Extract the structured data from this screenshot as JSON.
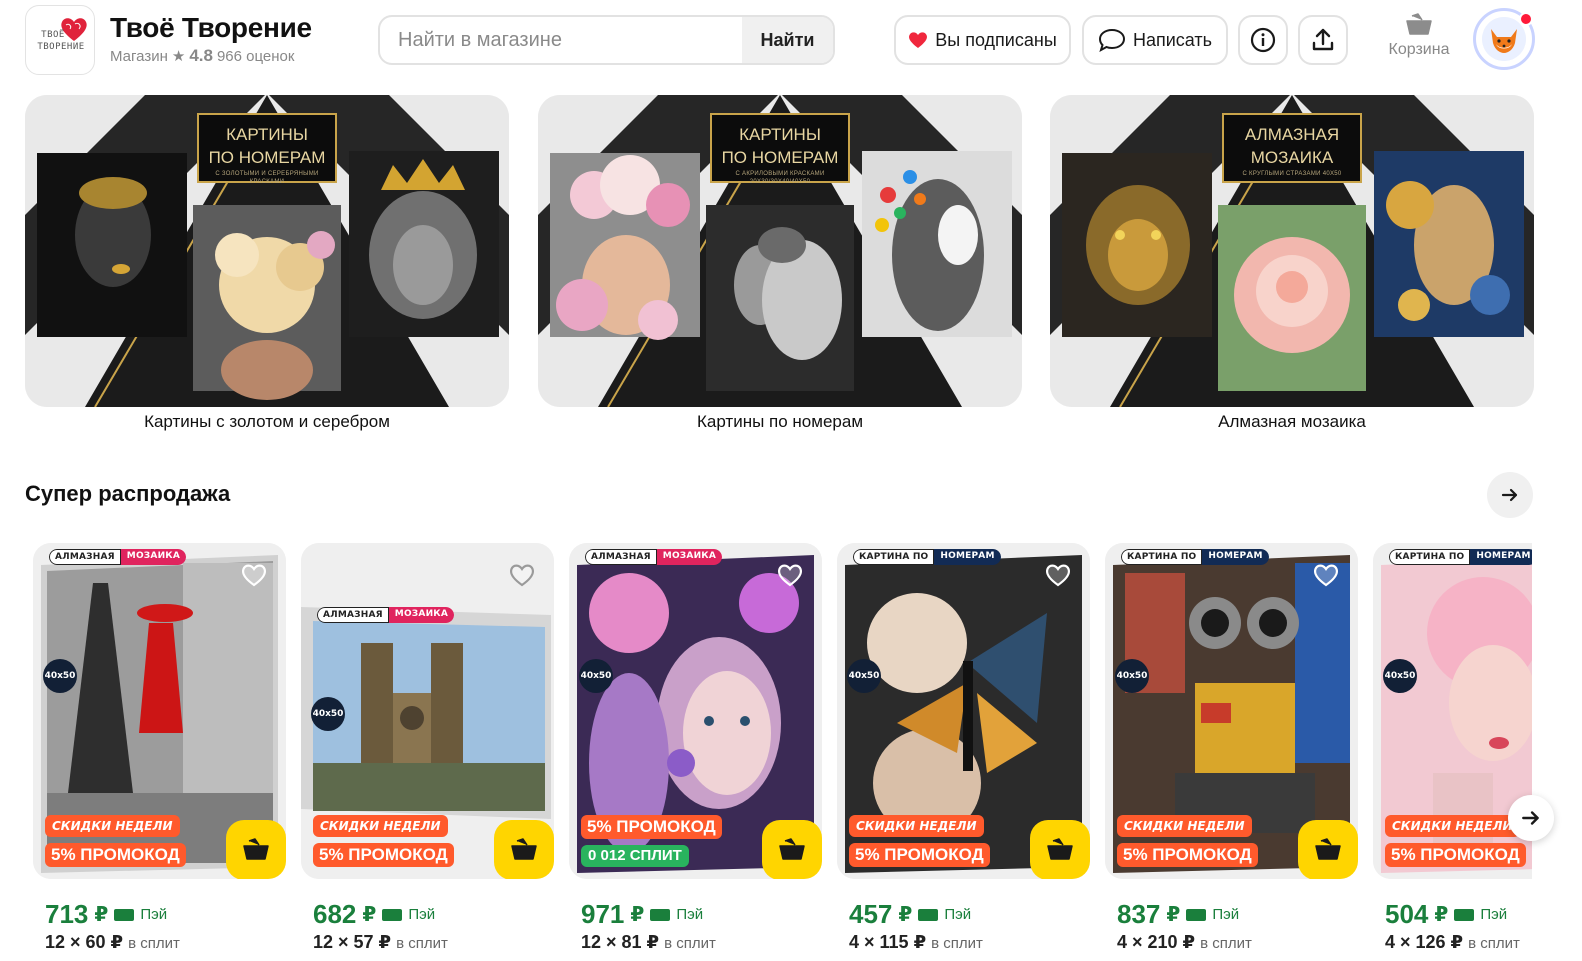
{
  "shop": {
    "logo_line1": "ТВОЁ",
    "logo_line2": "ТВОРЕНИЕ",
    "name": "Твоё Творение",
    "type_label": "Магазин",
    "rating": "4.8",
    "reviews": "966 оценок"
  },
  "search": {
    "placeholder": "Найти в магазине",
    "button": "Найти"
  },
  "actions": {
    "subscribed": "Вы подписаны",
    "write": "Написать",
    "cart": "Корзина"
  },
  "categories": [
    {
      "title_line1": "КАРТИНЫ",
      "title_line2": "ПО НОМЕРАМ",
      "title_small": "С ЗОЛОТЫМИ И СЕРЕБРЯНЫМИ КРАСКАМИ",
      "caption": "Картины с золотом и серебром"
    },
    {
      "title_line1": "КАРТИНЫ",
      "title_line2": "ПО НОМЕРАМ",
      "title_small": "С АКРИЛОВЫМИ КРАСКАМИ 20Х30/30Х40/40Х50",
      "caption": "Картины по номерам"
    },
    {
      "title_line1": "АЛМАЗНАЯ",
      "title_line2": "МОЗАИКА",
      "title_small": "С КРУГЛЫМИ СТРАЗАМИ 40Х50",
      "caption": "Алмазная мозаика"
    }
  ],
  "section": {
    "title": "Супер распродажа"
  },
  "products": [
    {
      "tag1": "АЛМАЗНАЯ",
      "tag2": "МОЗАИКА",
      "tag2_color": "#e0245e",
      "size": "40x50",
      "badge_week": "СКИДКИ НЕДЕЛИ",
      "badge_promo": "5% ПРОМОКОД",
      "price": "713",
      "currency": "₽",
      "pay": "Пэй",
      "split_amount": "12 × 60 ₽",
      "split_text": "в сплит"
    },
    {
      "tag1": "АЛМАЗНАЯ",
      "tag2": "МОЗАИКА",
      "tag2_color": "#e0245e",
      "size": "40x50",
      "badge_week": "СКИДКИ НЕДЕЛИ",
      "badge_promo": "5% ПРОМОКОД",
      "price": "682",
      "currency": "₽",
      "pay": "Пэй",
      "split_amount": "12 × 57 ₽",
      "split_text": "в сплит"
    },
    {
      "tag1": "АЛМАЗНАЯ",
      "tag2": "МОЗАИКА",
      "tag2_color": "#e0245e",
      "size": "40x50",
      "badge_week": "5% ПРОМОКОД",
      "badge_promo": "0 012 СПЛИТ",
      "price": "971",
      "currency": "₽",
      "pay": "Пэй",
      "split_amount": "12 × 81 ₽",
      "split_text": "в сплит"
    },
    {
      "tag1": "КАРТИНА ПО",
      "tag2": "НОМЕРАМ",
      "tag2_color": "#122b55",
      "size": "40x50",
      "badge_week": "СКИДКИ НЕДЕЛИ",
      "badge_promo": "5% ПРОМОКОД",
      "price": "457",
      "currency": "₽",
      "pay": "Пэй",
      "split_amount": "4 × 115 ₽",
      "split_text": "в сплит"
    },
    {
      "tag1": "КАРТИНА ПО",
      "tag2": "НОМЕРАМ",
      "tag2_color": "#122b55",
      "size": "40x50",
      "badge_week": "СКИДКИ НЕДЕЛИ",
      "badge_promo": "5% ПРОМОКОД",
      "price": "837",
      "currency": "₽",
      "pay": "Пэй",
      "split_amount": "4 × 210 ₽",
      "split_text": "в сплит"
    },
    {
      "tag1": "КАРТИНА ПО",
      "tag2": "НОМЕРАМ",
      "tag2_color": "#122b55",
      "size": "40x50",
      "badge_week": "СКИДКИ НЕДЕЛИ",
      "badge_promo": "5% ПРОМОКОД",
      "price": "504",
      "currency": "₽",
      "pay": "Пэй",
      "split_amount": "4 × 126 ₽",
      "split_text": "в сплит"
    }
  ],
  "colors": {
    "accent_yellow": "#ffd500",
    "price_green": "#1a7f3c",
    "promo_orange": "#ff5a2c",
    "split_green": "#29b35e"
  }
}
